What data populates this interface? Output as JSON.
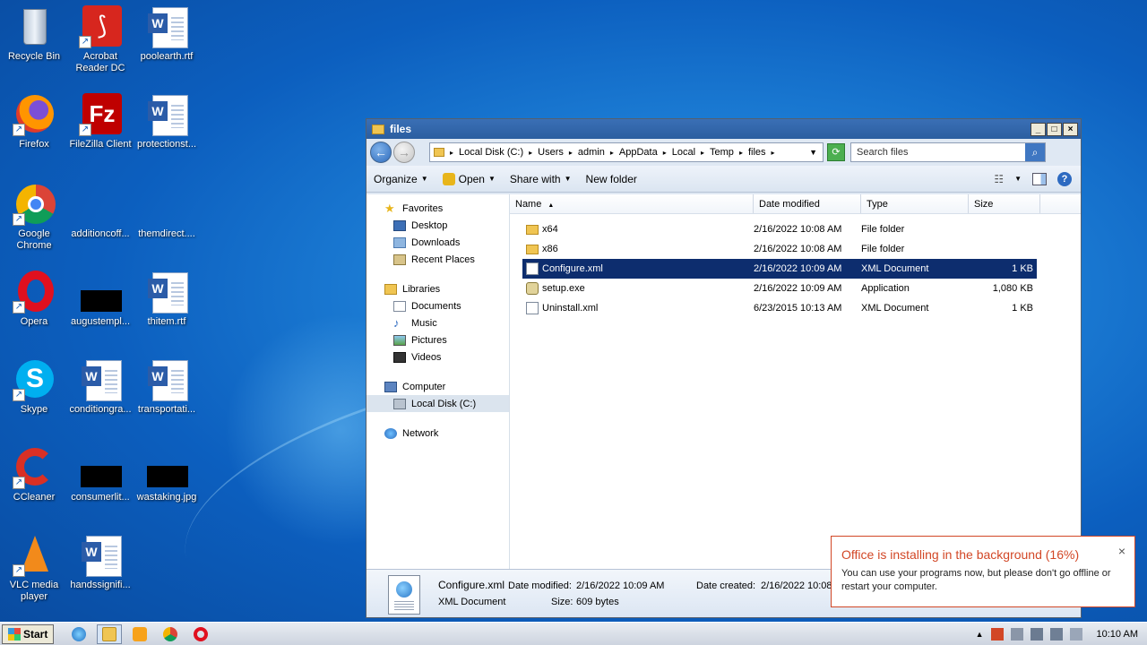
{
  "desktop": {
    "icons": [
      {
        "label": "Recycle Bin"
      },
      {
        "label": "Acrobat\nReader DC"
      },
      {
        "label": "poolearth.rtf"
      },
      {
        "label": "Firefox"
      },
      {
        "label": "FileZilla Client"
      },
      {
        "label": "protectionst..."
      },
      {
        "label": "Google\nChrome"
      },
      {
        "label": "additioncoff..."
      },
      {
        "label": "themdirect...."
      },
      {
        "label": "Opera"
      },
      {
        "label": "augustempl..."
      },
      {
        "label": "thitem.rtf"
      },
      {
        "label": "Skype"
      },
      {
        "label": "conditiongra..."
      },
      {
        "label": "transportati..."
      },
      {
        "label": "CCleaner"
      },
      {
        "label": "consumerlit..."
      },
      {
        "label": "wastaking.jpg"
      },
      {
        "label": "VLC media\nplayer"
      },
      {
        "label": "handssignifi..."
      }
    ]
  },
  "window": {
    "title": "files",
    "controls": {
      "minimize": "_",
      "maximize": "□",
      "close": "×"
    },
    "address": [
      "Local Disk (C:)",
      "Users",
      "admin",
      "AppData",
      "Local",
      "Temp",
      "files"
    ],
    "search_placeholder": "Search files",
    "toolbar": {
      "organize": "Organize",
      "open": "Open",
      "share_with": "Share with",
      "new_folder": "New folder"
    },
    "nav": {
      "favorites": "Favorites",
      "desktop": "Desktop",
      "downloads": "Downloads",
      "recent_places": "Recent Places",
      "libraries": "Libraries",
      "documents": "Documents",
      "music": "Music",
      "pictures": "Pictures",
      "videos": "Videos",
      "computer": "Computer",
      "local_disk": "Local Disk (C:)",
      "network": "Network"
    },
    "columns": {
      "name": "Name",
      "date": "Date modified",
      "type": "Type",
      "size": "Size"
    },
    "files": [
      {
        "name": "x64",
        "date": "2/16/2022 10:08 AM",
        "type": "File folder",
        "size": ""
      },
      {
        "name": "x86",
        "date": "2/16/2022 10:08 AM",
        "type": "File folder",
        "size": ""
      },
      {
        "name": "Configure.xml",
        "date": "2/16/2022 10:09 AM",
        "type": "XML Document",
        "size": "1 KB"
      },
      {
        "name": "setup.exe",
        "date": "2/16/2022 10:09 AM",
        "type": "Application",
        "size": "1,080 KB"
      },
      {
        "name": "Uninstall.xml",
        "date": "6/23/2015 10:13 AM",
        "type": "XML Document",
        "size": "1 KB"
      }
    ],
    "details": {
      "name": "Configure.xml",
      "type": "XML Document",
      "modified_label": "Date modified:",
      "modified_value": "2/16/2022 10:09 AM",
      "size_label": "Size:",
      "size_value": "609 bytes",
      "created_label": "Date created:",
      "created_value": "2/16/2022 10:08"
    }
  },
  "toast": {
    "title": "Office is installing in the background (16%)",
    "body": "You can use your programs now, but please don't go offline or restart your computer.",
    "close": "×",
    "accent": "#d24726"
  },
  "taskbar": {
    "start": "Start",
    "clock": "10:10 AM"
  }
}
